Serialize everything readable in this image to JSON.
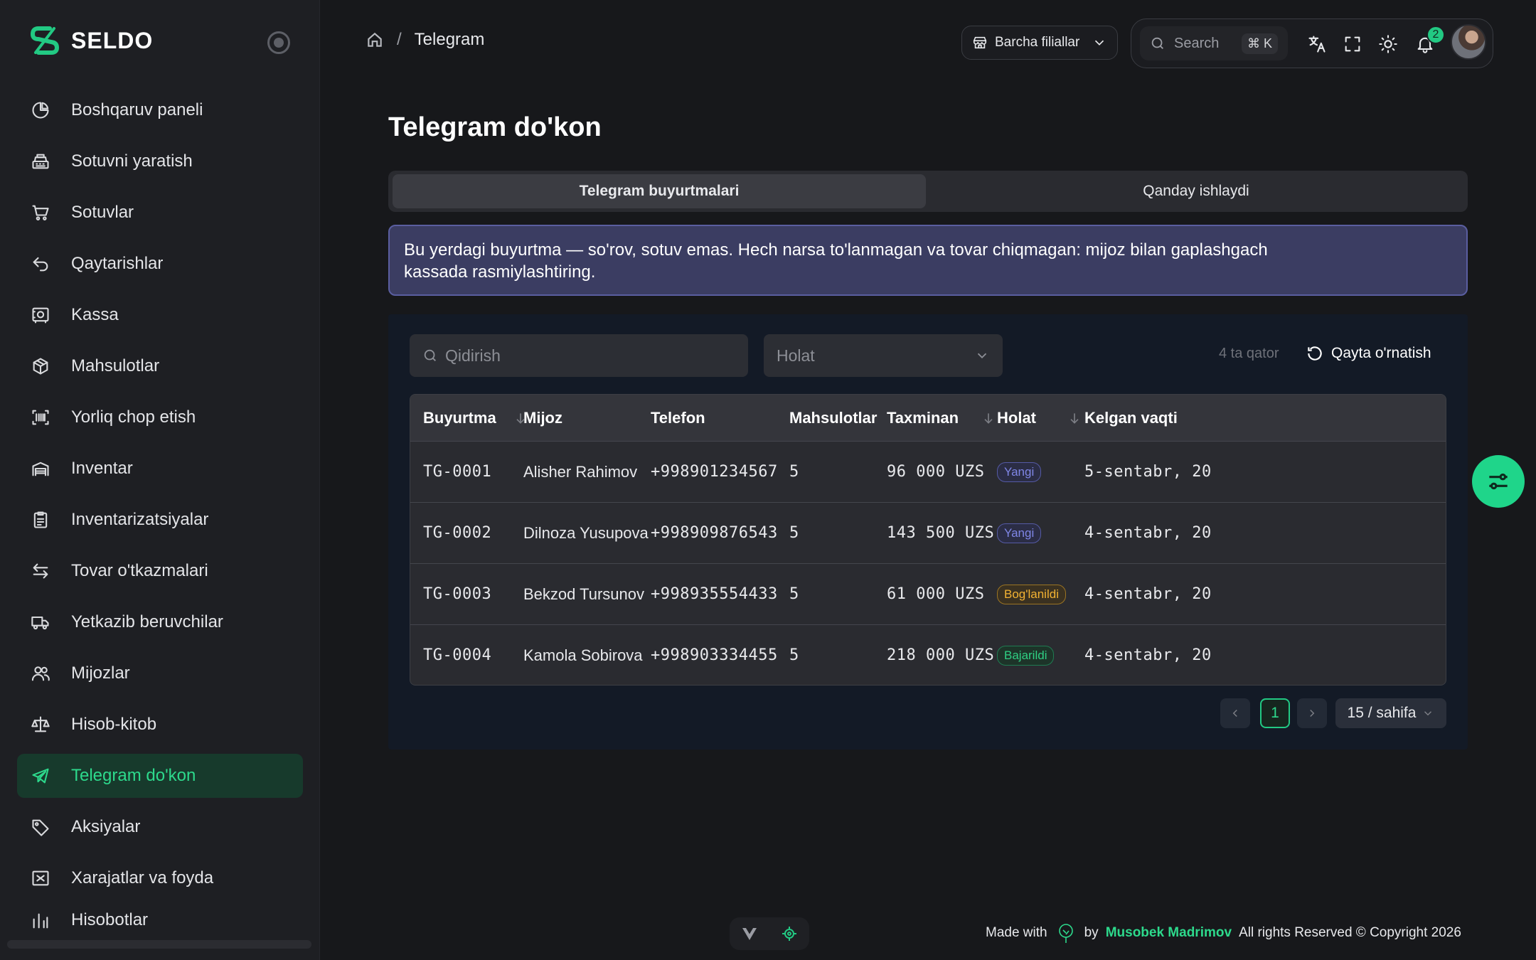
{
  "app": {
    "name": "SELDO",
    "brand_color": "#22c983"
  },
  "sidebar": {
    "items": [
      {
        "label": "Boshqaruv paneli",
        "icon": "pie-chart-icon"
      },
      {
        "label": "Sotuvni yaratish",
        "icon": "cash-register-icon"
      },
      {
        "label": "Sotuvlar",
        "icon": "shopping-cart-icon"
      },
      {
        "label": "Qaytarishlar",
        "icon": "return-arrow-icon"
      },
      {
        "label": "Kassa",
        "icon": "safe-icon"
      },
      {
        "label": "Mahsulotlar",
        "icon": "box-icon"
      },
      {
        "label": "Yorliq chop etish",
        "icon": "barcode-icon"
      },
      {
        "label": "Inventar",
        "icon": "warehouse-icon"
      },
      {
        "label": "Inventarizatsiyalar",
        "icon": "clipboard-icon"
      },
      {
        "label": "Tovar o'tkazmalari",
        "icon": "transfer-icon"
      },
      {
        "label": "Yetkazib beruvchilar",
        "icon": "truck-icon"
      },
      {
        "label": "Mijozlar",
        "icon": "users-icon"
      },
      {
        "label": "Hisob-kitob",
        "icon": "scale-icon"
      },
      {
        "label": "Telegram do'kon",
        "icon": "telegram-icon",
        "active": true
      },
      {
        "label": "Aksiyalar",
        "icon": "tag-icon"
      },
      {
        "label": "Xarajatlar va foyda",
        "icon": "expense-icon"
      },
      {
        "label": "Hisobotlar",
        "icon": "report-icon"
      }
    ]
  },
  "header": {
    "breadcrumb": {
      "current": "Telegram"
    },
    "branch_select": "Barcha filiallar",
    "search_placeholder": "Search",
    "shortcut": "⌘ K",
    "notifications_count": "2"
  },
  "main": {
    "title": "Telegram do'kon",
    "tabs": [
      {
        "label": "Telegram buyurtmalari",
        "active": true
      },
      {
        "label": "Qanday ishlaydi"
      }
    ],
    "notice_line1": "Bu yerdagi buyurtma — so'rov, sotuv emas. Hech narsa to'lanmagan va tovar chiqmagan: mijoz bilan gaplashgach",
    "notice_line2": "kassada rasmiylashtiring.",
    "filters": {
      "search_placeholder": "Qidirish",
      "status_placeholder": "Holat",
      "row_count": "4 ta qator",
      "reset_label": "Qayta o'rnatish"
    },
    "table": {
      "columns": [
        "Buyurtma",
        "Mijoz",
        "Telefon",
        "Mahsulotlar",
        "Taxminan",
        "Holat",
        "Kelgan vaqti"
      ],
      "rows": [
        {
          "order": "TG-0001",
          "customer": "Alisher Rahimov",
          "phone": "+998901234567",
          "items": "5",
          "amount": "96 000 UZS",
          "status": "Yangi",
          "status_kind": "new",
          "time": "5-sentabr, 20"
        },
        {
          "order": "TG-0002",
          "customer": "Dilnoza Yusupova",
          "phone": "+998909876543",
          "items": "5",
          "amount": "143 500 UZS",
          "status": "Yangi",
          "status_kind": "new",
          "time": "4-sentabr, 20"
        },
        {
          "order": "TG-0003",
          "customer": "Bekzod Tursunov",
          "phone": "+998935554433",
          "items": "5",
          "amount": "61 000 UZS",
          "status": "Bog'lanildi",
          "status_kind": "contacted",
          "time": "4-sentabr, 20"
        },
        {
          "order": "TG-0004",
          "customer": "Kamola Sobirova",
          "phone": "+998903334455",
          "items": "5",
          "amount": "218 000 UZS",
          "status": "Bajarildi",
          "status_kind": "done",
          "time": "4-sentabr, 20"
        }
      ]
    },
    "pagination": {
      "current_page": "1",
      "page_size": "15 / sahifa"
    }
  },
  "footer": {
    "made_with": "Made with",
    "by": "by",
    "author": "Musobek Madrimov",
    "rights": "All rights Reserved © Copyright 2026"
  }
}
